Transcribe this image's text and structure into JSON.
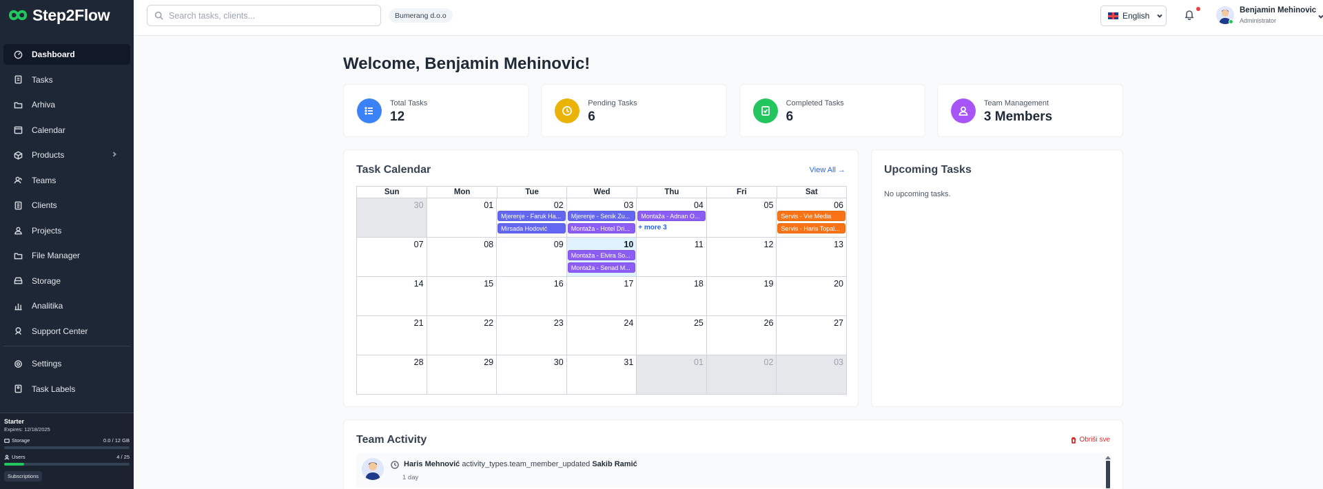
{
  "app": {
    "name": "Step2Flow"
  },
  "sidebar": {
    "items": [
      {
        "label": "Dashboard",
        "icon": "dashboard-icon",
        "active": true
      },
      {
        "label": "Tasks",
        "icon": "tasks-icon"
      },
      {
        "label": "Arhiva",
        "icon": "folder-icon"
      },
      {
        "label": "Calendar",
        "icon": "calendar-icon"
      },
      {
        "label": "Products",
        "icon": "box-icon",
        "has_children": true
      },
      {
        "label": "Teams",
        "icon": "team-icon"
      },
      {
        "label": "Clients",
        "icon": "clients-icon"
      },
      {
        "label": "Projects",
        "icon": "projects-icon"
      },
      {
        "label": "File Manager",
        "icon": "folder-icon"
      },
      {
        "label": "Storage",
        "icon": "storage-icon"
      },
      {
        "label": "Analitika",
        "icon": "analytics-icon"
      },
      {
        "label": "Support Center",
        "icon": "support-icon"
      }
    ],
    "bottom_items": [
      {
        "label": "Settings",
        "icon": "gear-icon"
      },
      {
        "label": "Task Labels",
        "icon": "label-icon"
      }
    ],
    "plan": {
      "name": "Starter",
      "expires": "Expires: 12/18/2025",
      "storage_label": "Storage",
      "storage_value": "0.0 / 12 GB",
      "storage_fraction": 0.0,
      "users_label": "Users",
      "users_value": "4 / 25",
      "users_fraction": 0.16,
      "subscriptions_label": "Subscriptions"
    }
  },
  "header": {
    "search_placeholder": "Search tasks, clients...",
    "company": "Bumerang d.o.o",
    "language": "English",
    "user_name": "Benjamin Mehinovic",
    "user_role": "Administrator"
  },
  "main": {
    "welcome": "Welcome, Benjamin Mehinovic!",
    "stats": [
      {
        "label": "Total Tasks",
        "value": "12",
        "color": "#3b82f6",
        "icon": "list-icon"
      },
      {
        "label": "Pending Tasks",
        "value": "6",
        "color": "#eab308",
        "icon": "clock-icon"
      },
      {
        "label": "Completed Tasks",
        "value": "6",
        "color": "#22c55e",
        "icon": "check-icon"
      },
      {
        "label": "Team Management",
        "value": "3 Members",
        "color": "#a855f7",
        "icon": "user-icon"
      }
    ],
    "calendar": {
      "title": "Task Calendar",
      "view_all": "View All →",
      "weekdays": [
        "Sun",
        "Mon",
        "Tue",
        "Wed",
        "Thu",
        "Fri",
        "Sat"
      ],
      "days": [
        {
          "n": "30",
          "other": true
        },
        {
          "n": "01"
        },
        {
          "n": "02",
          "events": [
            {
              "t": "Mjerenje - Faruk Ha...",
              "c": "indigo"
            },
            {
              "t": "Mirsada Hodović",
              "c": "indigo"
            }
          ]
        },
        {
          "n": "03",
          "events": [
            {
              "t": "Mjerenje - Senik Zu...",
              "c": "indigo"
            },
            {
              "t": "Montaža - Hotel Dri...",
              "c": "violet"
            }
          ]
        },
        {
          "n": "04",
          "events": [
            {
              "t": "Montaža - Adnan O...",
              "c": "violet"
            }
          ],
          "more": "+ more 3"
        },
        {
          "n": "05"
        },
        {
          "n": "06",
          "events": [
            {
              "t": "Servis - Vie Media",
              "c": "orange"
            },
            {
              "t": "Servis - Haris Topal...",
              "c": "orange"
            }
          ]
        },
        {
          "n": "07"
        },
        {
          "n": "08"
        },
        {
          "n": "09"
        },
        {
          "n": "10",
          "today": true,
          "events": [
            {
              "t": "Montaža - Elvira So...",
              "c": "violet"
            },
            {
              "t": "Montaža - Senad M...",
              "c": "violet"
            }
          ]
        },
        {
          "n": "11"
        },
        {
          "n": "12"
        },
        {
          "n": "13"
        },
        {
          "n": "14"
        },
        {
          "n": "15"
        },
        {
          "n": "16"
        },
        {
          "n": "17"
        },
        {
          "n": "18"
        },
        {
          "n": "19"
        },
        {
          "n": "20"
        },
        {
          "n": "21"
        },
        {
          "n": "22"
        },
        {
          "n": "23"
        },
        {
          "n": "24"
        },
        {
          "n": "25"
        },
        {
          "n": "26"
        },
        {
          "n": "27"
        },
        {
          "n": "28"
        },
        {
          "n": "29"
        },
        {
          "n": "30"
        },
        {
          "n": "31"
        },
        {
          "n": "01",
          "other": true
        },
        {
          "n": "02",
          "other": true
        },
        {
          "n": "03",
          "other": true
        }
      ]
    },
    "upcoming": {
      "title": "Upcoming Tasks",
      "empty": "No upcoming tasks."
    },
    "activity": {
      "title": "Team Activity",
      "clear_label": "Obriši sve",
      "items": [
        {
          "actor": "Haris Mehnović",
          "action": "activity_types.team_member_updated",
          "target": "Sakib Ramić",
          "time": "1 day"
        }
      ]
    }
  }
}
